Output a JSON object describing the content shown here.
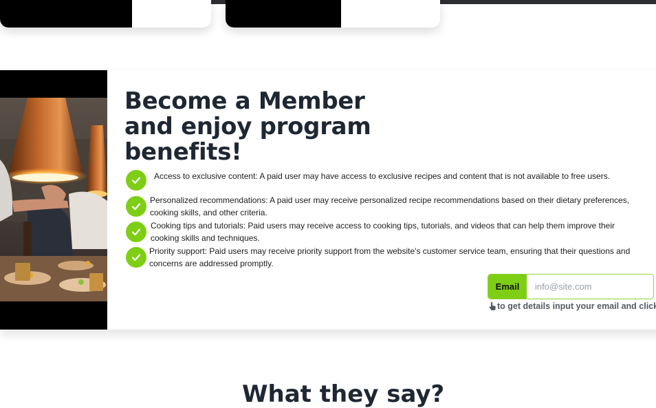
{
  "membership": {
    "title": "Become a Member and enjoy program benefits!",
    "benefits": [
      {
        "text": "Access to exclusive content: A paid user may have access to exclusive recipes and content that is not available to free users."
      },
      {
        "text": "Personalized recommendations: A paid user may receive personalized recipe recommendations based on their dietary preferences, cooking skills, and other criteria."
      },
      {
        "text": "Cooking tips and tutorials: Paid users may receive access to cooking tips, tutorials, and videos that can help them improve their cooking skills and techniques."
      },
      {
        "text": "Priority support: Paid users may receive priority support from the website's customer service team, ensuring that their questions and concerns are addressed promptly."
      }
    ],
    "email": {
      "label": "Email",
      "placeholder": "info@site.com",
      "value": ""
    },
    "hint": "to get details input your email and click",
    "colors": {
      "accent": "#7fce16",
      "heading": "#1f2732"
    }
  },
  "next_section": {
    "title": "What they say?"
  }
}
